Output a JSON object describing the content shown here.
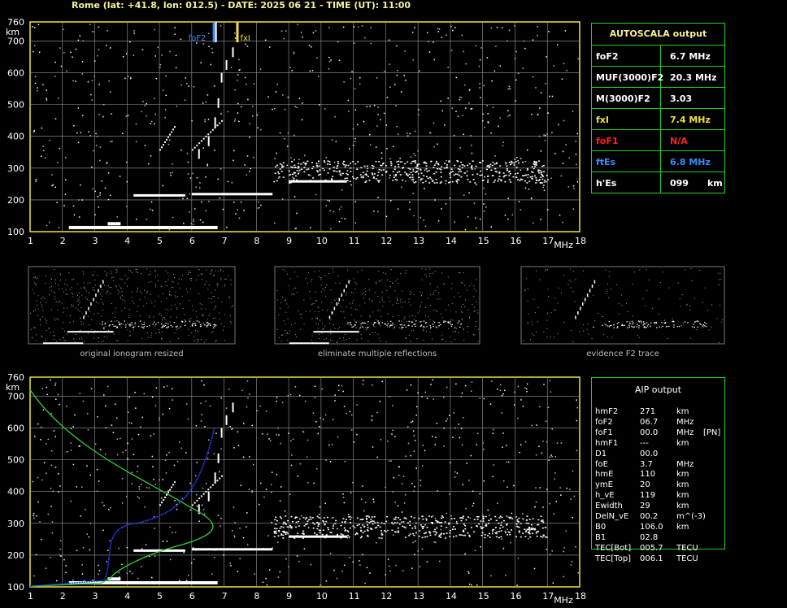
{
  "header": {
    "text": "Rome (lat: +41.8, lon: 012.5) - DATE: 2025 06 21 - TIME (UT): 11:00"
  },
  "axes": {
    "y_ticks": [
      "760",
      "700",
      "600",
      "500",
      "400",
      "300",
      "200",
      "100"
    ],
    "y_unit": "km",
    "x_ticks": [
      "1",
      "2",
      "3",
      "4",
      "5",
      "6",
      "7",
      "8",
      "9",
      "10",
      "11",
      "12",
      "13",
      "14",
      "15",
      "16",
      "17",
      "18"
    ],
    "x_unit": "MHz"
  },
  "markers": {
    "foE2_label": "foF2",
    "fxI_label": "fxI"
  },
  "autoscala": {
    "title": "AUTOSCALA output",
    "rows": [
      {
        "label": "foF2",
        "value": "6.7 MHz",
        "color": "#ffffff"
      },
      {
        "label": "MUF(3000)F2",
        "value": "20.3 MHz",
        "color": "#ffffff"
      },
      {
        "label": "M(3000)F2",
        "value": "3.03",
        "color": "#ffffff"
      },
      {
        "label": "fxI",
        "value": "7.4 MHz",
        "color": "#f2e233"
      },
      {
        "label": "foF1",
        "value": "N/A",
        "color": "#ff2020"
      },
      {
        "label": "ftEs",
        "value": "6.8 MHz",
        "color": "#3b8cff"
      },
      {
        "label": "h'Es",
        "value": "099      km",
        "color": "#ffffff"
      }
    ]
  },
  "thumbnails": [
    {
      "caption": "original ionogram resized"
    },
    {
      "caption": "eliminate multiple reflections"
    },
    {
      "caption": "evidence F2 trace"
    }
  ],
  "aip": {
    "title": "AIP output",
    "rows": [
      {
        "label": "hmF2",
        "value": "271",
        "unit": "km",
        "extra": ""
      },
      {
        "label": "foF2",
        "value": "06.7",
        "unit": "MHz",
        "extra": ""
      },
      {
        "label": "foF1",
        "value": "00.0",
        "unit": "MHz",
        "extra": "[PN]"
      },
      {
        "label": "hmF1",
        "value": "---",
        "unit": "km",
        "extra": ""
      },
      {
        "label": "D1",
        "value": "00.0",
        "unit": "",
        "extra": ""
      },
      {
        "label": "foE",
        "value": "3.7",
        "unit": "MHz",
        "extra": ""
      },
      {
        "label": "hmE",
        "value": "110",
        "unit": "km",
        "extra": ""
      },
      {
        "label": "ymE",
        "value": "20",
        "unit": "km",
        "extra": ""
      },
      {
        "label": "h_vE",
        "value": "119",
        "unit": "km",
        "extra": ""
      },
      {
        "label": "Ewidth",
        "value": "29",
        "unit": "km",
        "extra": ""
      },
      {
        "label": "DelN_vE",
        "value": "00.2",
        "unit": "m^(-3)",
        "extra": ""
      },
      {
        "label": "B0",
        "value": "106.0",
        "unit": "km",
        "extra": ""
      },
      {
        "label": "B1",
        "value": "02.8",
        "unit": "",
        "extra": ""
      },
      {
        "label": "TEC[Bot]",
        "value": "005.7",
        "unit": "TECU",
        "extra": ""
      },
      {
        "label": "TEC[Top]",
        "value": "006.1",
        "unit": "TECU",
        "extra": ""
      }
    ]
  }
}
